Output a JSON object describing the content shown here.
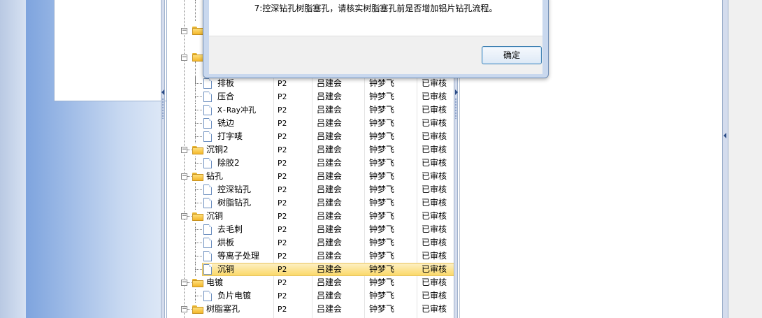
{
  "dialog": {
    "message": "7:控深钻孔树脂塞孔，请核实树脂塞孔前是否增加铝片钻孔流程。",
    "ok_label": "确定"
  },
  "grid": {
    "rows": [
      {
        "type": "doc",
        "name": "排板",
        "p": "P2",
        "a": "吕建会",
        "b": "钟梦飞",
        "s": "已审核"
      },
      {
        "type": "doc",
        "name": "压合",
        "p": "P2",
        "a": "吕建会",
        "b": "钟梦飞",
        "s": "已审核"
      },
      {
        "type": "doc",
        "name": "X-Ray冲孔",
        "p": "P2",
        "a": "吕建会",
        "b": "钟梦飞",
        "s": "已审核"
      },
      {
        "type": "doc",
        "name": "铣边",
        "p": "P2",
        "a": "吕建会",
        "b": "钟梦飞",
        "s": "已审核"
      },
      {
        "type": "doc",
        "name": "打字唛",
        "p": "P2",
        "a": "吕建会",
        "b": "钟梦飞",
        "s": "已审核"
      },
      {
        "type": "folder",
        "name": "沉铜2",
        "p": "P2",
        "a": "吕建会",
        "b": "钟梦飞",
        "s": "已审核"
      },
      {
        "type": "doc",
        "name": "除胶2",
        "p": "P2",
        "a": "吕建会",
        "b": "钟梦飞",
        "s": "已审核"
      },
      {
        "type": "folder",
        "name": "钻孔",
        "p": "P2",
        "a": "吕建会",
        "b": "钟梦飞",
        "s": "已审核"
      },
      {
        "type": "doc",
        "name": "控深钻孔",
        "p": "P2",
        "a": "吕建会",
        "b": "钟梦飞",
        "s": "已审核"
      },
      {
        "type": "doc",
        "name": "树脂钻孔",
        "p": "P2",
        "a": "吕建会",
        "b": "钟梦飞",
        "s": "已审核"
      },
      {
        "type": "folder",
        "name": "沉铜",
        "p": "P2",
        "a": "吕建会",
        "b": "钟梦飞",
        "s": "已审核"
      },
      {
        "type": "doc",
        "name": "去毛刺",
        "p": "P2",
        "a": "吕建会",
        "b": "钟梦飞",
        "s": "已审核"
      },
      {
        "type": "doc",
        "name": "烘板",
        "p": "P2",
        "a": "吕建会",
        "b": "钟梦飞",
        "s": "已审核"
      },
      {
        "type": "doc",
        "name": "等离子处理",
        "p": "P2",
        "a": "吕建会",
        "b": "钟梦飞",
        "s": "已审核"
      },
      {
        "type": "doc",
        "name": "沉铜",
        "p": "P2",
        "a": "吕建会",
        "b": "钟梦飞",
        "s": "已审核",
        "selected": true
      },
      {
        "type": "folder",
        "name": "电镀",
        "p": "P2",
        "a": "吕建会",
        "b": "钟梦飞",
        "s": "已审核"
      },
      {
        "type": "doc",
        "name": "负片电镀",
        "p": "P2",
        "a": "吕建会",
        "b": "钟梦飞",
        "s": "已审核"
      },
      {
        "type": "folder",
        "name": "树脂塞孔",
        "p": "P2",
        "a": "吕建会",
        "b": "钟梦飞",
        "s": "已审核"
      }
    ]
  }
}
